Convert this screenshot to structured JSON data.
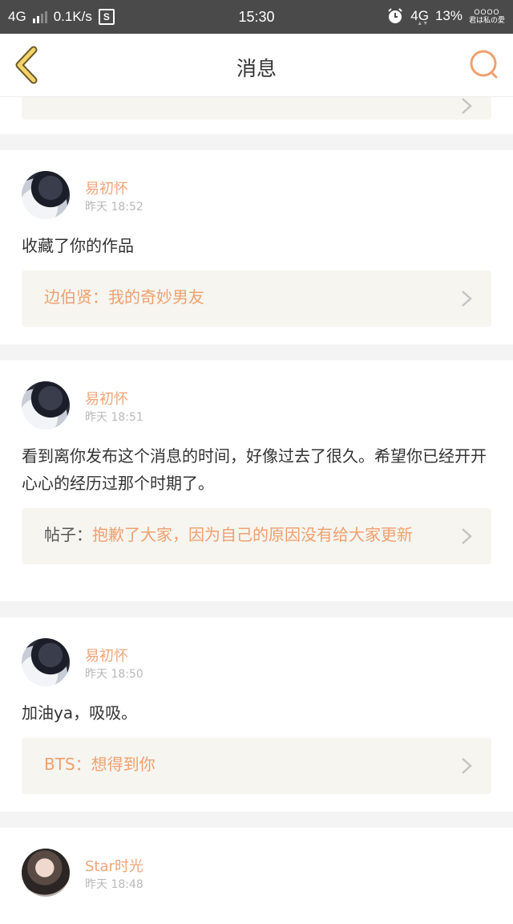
{
  "status_bar": {
    "network": "4G",
    "speed": "0.1K/s",
    "s_icon": "S",
    "time": "15:30",
    "network_right": "4G",
    "battery": "13%",
    "brand_line1": "OOOO",
    "brand_line2": "君は私の愛"
  },
  "nav": {
    "title": "消息",
    "back_icon": "chevron-left-icon",
    "search_icon": "search-icon",
    "accent_color": "#f0a06e"
  },
  "messages": [
    {
      "name": "易初怀",
      "time": "昨天 18:52",
      "text": "收藏了你的作品",
      "quote_lead": "",
      "quote": "边伯贤：我的奇妙男友"
    },
    {
      "name": "易初怀",
      "time": "昨天 18:51",
      "text": "看到离你发布这个消息的时间，好像过去了很久。希望你已经开开心心的经历过那个时期了。",
      "quote_lead": "帖子：",
      "quote": "抱歉了大家，因为自己的原因没有给大家更新"
    },
    {
      "name": "易初怀",
      "time": "昨天 18:50",
      "text": "加油ya，吸吸。",
      "quote_lead": "",
      "quote": "BTS：想得到你"
    },
    {
      "name": "Star时光",
      "time": "昨天 18:48",
      "text": "",
      "quote_lead": "",
      "quote": ""
    }
  ]
}
